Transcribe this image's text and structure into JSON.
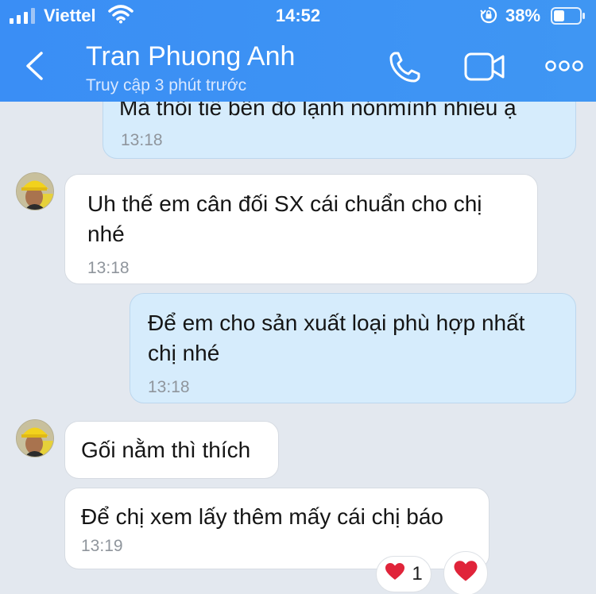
{
  "status_bar": {
    "carrier": "Viettel",
    "time": "14:52",
    "battery": "38%"
  },
  "header": {
    "contact_name": "Tran Phuong Anh",
    "last_seen": "Truy cập 3 phút trước"
  },
  "messages": [
    {
      "direction": "out",
      "text": "Mà thôi tiề bên đó lạnh nónmình nhiều ạ",
      "time": "13:18"
    },
    {
      "direction": "in",
      "text": " Uh thế em cân đối SX cái chuẩn cho chị nhé",
      "time": "13:18"
    },
    {
      "direction": "out",
      "text": "Để em cho sản xuất loại phù hợp nhất chị nhé",
      "time": "13:18"
    },
    {
      "direction": "in",
      "text": "Gối nằm thì thích"
    },
    {
      "direction": "in",
      "text": "Để chị xem lấy thêm mấy cái chị báo",
      "time": "13:19"
    }
  ],
  "reaction": {
    "icon": "heart-icon",
    "count": "1"
  },
  "colors": {
    "header": "#3a8ef5",
    "background": "#e3e8ef",
    "outgoing_bubble": "#d6ecfc",
    "incoming_bubble": "#ffffff",
    "heart": "#e0243a"
  }
}
